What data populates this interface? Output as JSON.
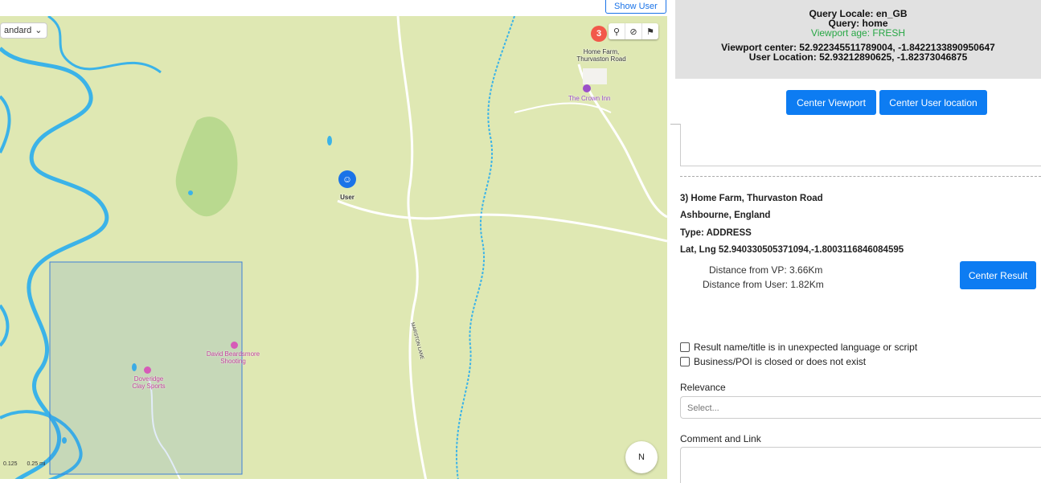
{
  "map": {
    "show_user_label": "Show User",
    "map_style": "andard",
    "result_marker_number": "3",
    "result_marker_label_line1": "Home Farm,",
    "result_marker_label_line2": "Thurvaston Road",
    "crown_inn_label": "The Crown Inn",
    "user_marker_label": "User",
    "poi_shooting_line1": "David Beardsmore",
    "poi_shooting_line2": "Shooting",
    "poi_clay_line1": "Doveridge",
    "poi_clay_line2": "Clay Sports",
    "road_label": "MARSTON LANE",
    "compass_label": "N",
    "scale_left": "0.125",
    "scale_right": "0.25 mi",
    "colors": {
      "land": "#dfe8b3",
      "river": "#3bb3e8",
      "forest": "#b6d88b",
      "selection": "#3d7fd9",
      "pin": "#f2584a",
      "user": "#1a73e8"
    }
  },
  "query": {
    "locale": "Query Locale: en_GB",
    "query": "Query: home",
    "viewport_age": "Viewport age: FRESH",
    "viewport_center": "Viewport center: 52.922345511789004, -1.8422133890950647",
    "user_location": "User Location: 52.93212890625, -1.82373046875"
  },
  "buttons": {
    "center_viewport": "Center Viewport",
    "center_user_location": "Center User location",
    "center_result": "Center Result"
  },
  "result": {
    "title": "3) Home Farm, Thurvaston Road",
    "locality": "Ashbourne, England",
    "type": "Type: ADDRESS",
    "latlng": "Lat, Lng 52.940330505371094,-1.8003116846084595",
    "distance_vp": "Distance from VP: 3.66Km",
    "distance_user": "Distance from User: 1.82Km"
  },
  "checks": {
    "unexpected_language": "Result name/title is in unexpected language or script",
    "closed": "Business/POI is closed or does not exist"
  },
  "form": {
    "relevance_label": "Relevance",
    "relevance_placeholder": "Select...",
    "comment_label": "Comment and Link"
  }
}
